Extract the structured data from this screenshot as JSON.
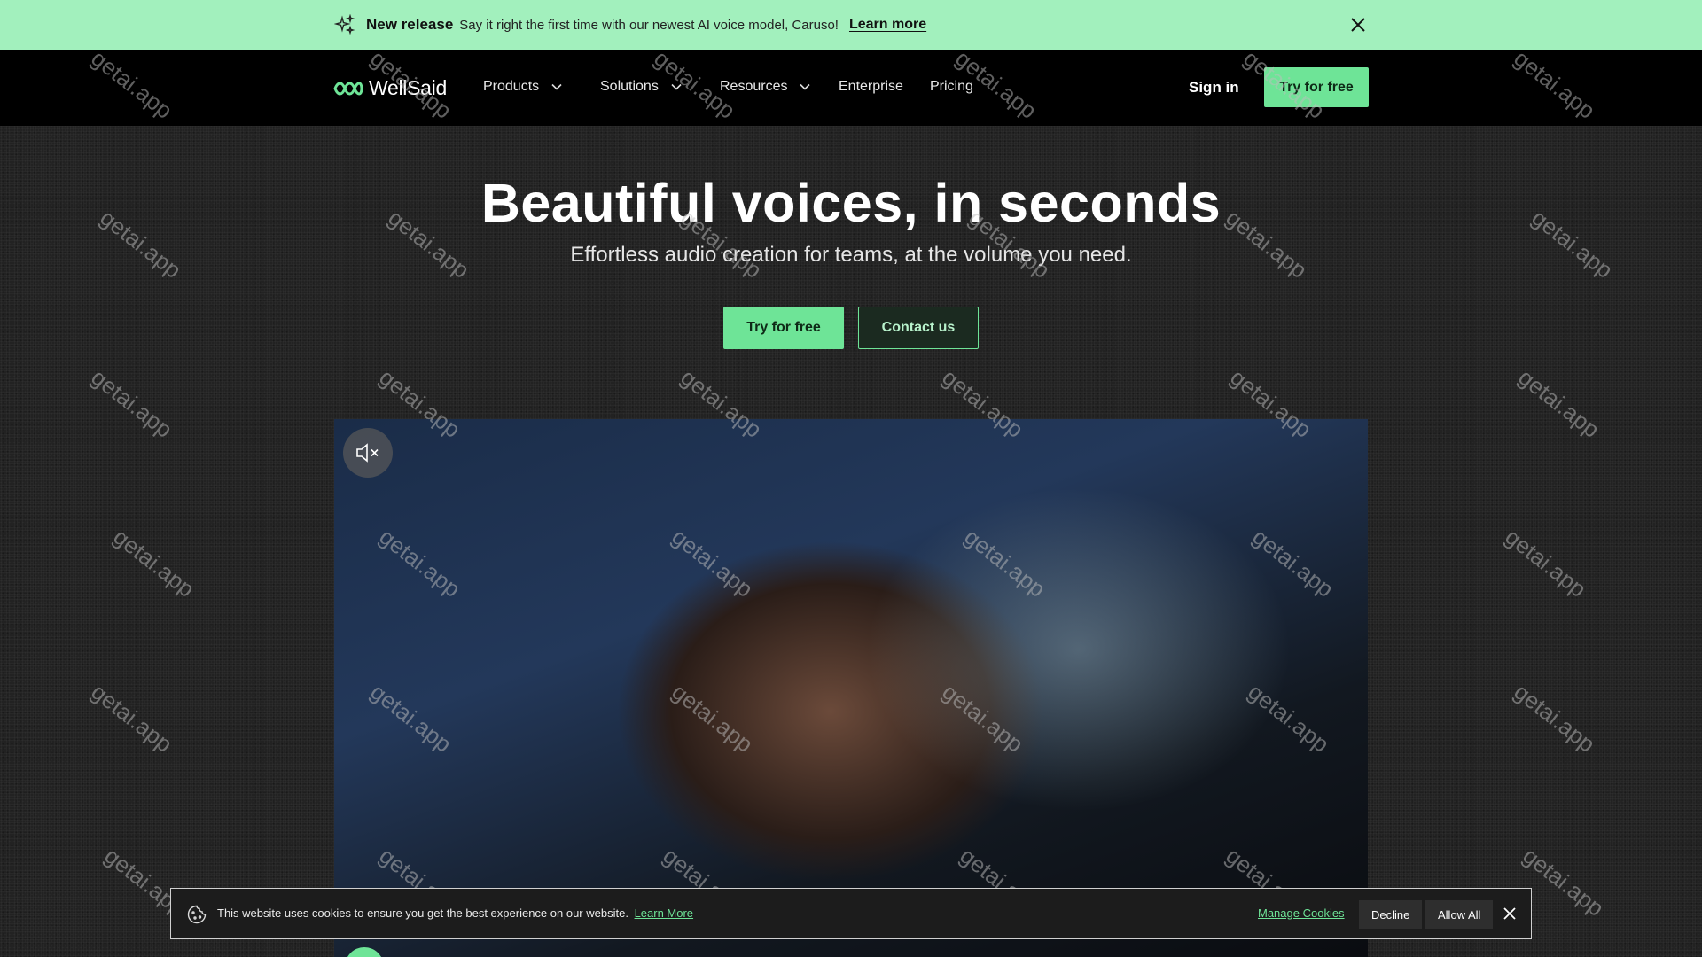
{
  "banner": {
    "title": "New release",
    "text": "Say it right the first time with our newest AI voice model, Caruso!",
    "link": "Learn more"
  },
  "nav": {
    "logo": "WellSaid",
    "items": [
      "Products",
      "Solutions",
      "Resources",
      "Enterprise",
      "Pricing"
    ],
    "sign_in": "Sign in",
    "cta": "Try for free"
  },
  "hero": {
    "title": "Beautiful voices, in seconds",
    "subtitle": "Effortless audio creation for teams, at the volume you need.",
    "primary_button": "Try for free",
    "secondary_button": "Contact us"
  },
  "video": {
    "mute_icon": "speaker-muted-icon"
  },
  "cookie": {
    "text": "This website uses cookies to ensure you get the best experience on our website.",
    "learn_more": "Learn More",
    "manage": "Manage Cookies",
    "decline": "Decline",
    "allow_all": "Allow All"
  },
  "watermark": "getai.app",
  "colors": {
    "accent": "#6ee497",
    "banner_bg": "#a2f0bd",
    "page_bg": "#222222",
    "nav_bg": "#000000"
  }
}
